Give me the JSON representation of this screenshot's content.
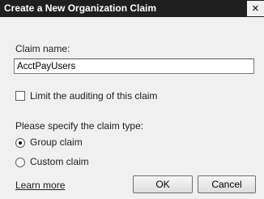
{
  "window": {
    "title": "Create a New Organization Claim",
    "close_glyph": "×"
  },
  "form": {
    "claim_name_label": "Claim name:",
    "claim_name_value": "AcctPayUsers",
    "limit_auditing_label": "Limit the auditing of this claim",
    "limit_auditing_checked": false,
    "claim_type_prompt": "Please specify the claim type:",
    "claim_types": [
      {
        "label": "Group claim",
        "selected": true
      },
      {
        "label": "Custom claim",
        "selected": false
      }
    ]
  },
  "footer": {
    "learn_more": "Learn more",
    "ok_label": "OK",
    "cancel_label": "Cancel"
  }
}
